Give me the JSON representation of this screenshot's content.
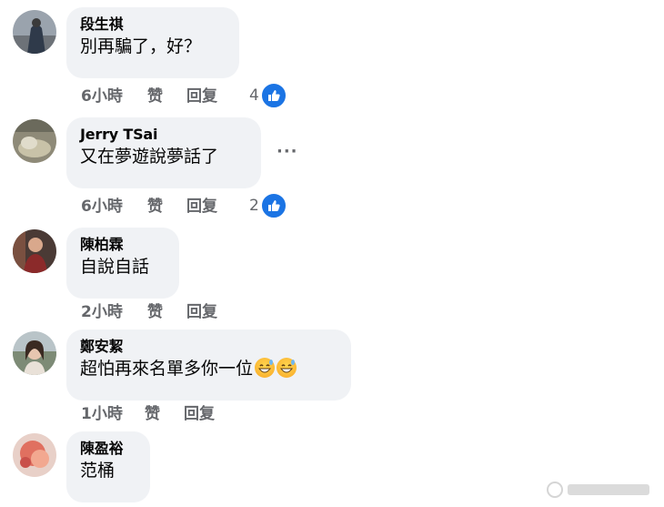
{
  "comments": [
    {
      "author": "段生祺",
      "text": "別再騙了，好？",
      "time": "6小時",
      "like_label": "赞",
      "reply_label": "回复",
      "reaction_count": "4"
    },
    {
      "author": "Jerry TSai",
      "text": "又在夢遊說夢話了",
      "time": "6小時",
      "like_label": "赞",
      "reply_label": "回复",
      "reaction_count": "2",
      "more": "···"
    },
    {
      "author": "陳柏霖",
      "text": "自說自話",
      "time": "2小時",
      "like_label": "赞",
      "reply_label": "回复"
    },
    {
      "author": "鄭安絜",
      "text": "超怕再來名單多你一位",
      "time": "1小時",
      "like_label": "赞",
      "reply_label": "回复"
    },
    {
      "author": "陳盈裕",
      "text": "范桶"
    }
  ],
  "colors": {
    "bubble": "#f0f2f5",
    "like_blue": "#1b74e4",
    "secondary_text": "#65676b"
  },
  "icons": {
    "reaction": "like-thumbs-up-icon",
    "emoji": "grinning-sweat-emoji"
  }
}
